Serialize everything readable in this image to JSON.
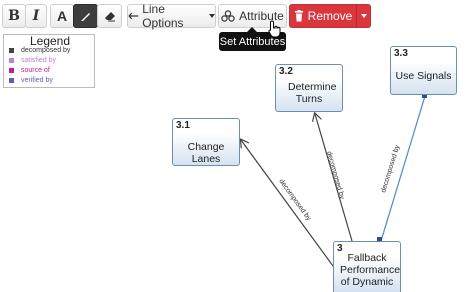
{
  "toolbar": {
    "bold_label": "B",
    "italic_label": "I",
    "text_color_label": "A",
    "line_options_label": "Line Options",
    "attribute_label": "Attribute",
    "remove_label": "Remove",
    "tooltip": "Set Attributes"
  },
  "legend": {
    "title": "Legend",
    "items": [
      {
        "label": "decomposed by",
        "color": "#444444"
      },
      {
        "label": "satisfied by",
        "color": "#c07fd8"
      },
      {
        "label": "source of",
        "color": "#c01f8f"
      },
      {
        "label": "verified by",
        "color": "#6a5bb0"
      }
    ]
  },
  "nodes": [
    {
      "id": "3.1",
      "title": "Change Lanes"
    },
    {
      "id": "3.2",
      "title": "Determine Turns"
    },
    {
      "id": "3.3",
      "title": "Use Signals"
    },
    {
      "id": "3",
      "title": "Fallback Performance of Dynamic"
    }
  ],
  "edges": [
    {
      "label": "decomposed by",
      "color": "#444444"
    },
    {
      "label": "decomposed by",
      "color": "#444444"
    },
    {
      "label": "decomposed by",
      "color": "#5b8fd0"
    }
  ]
}
